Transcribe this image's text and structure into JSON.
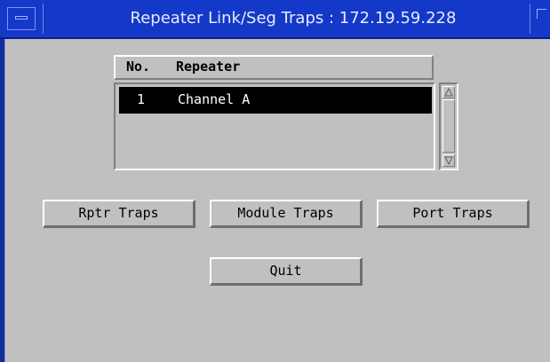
{
  "window": {
    "title": "Repeater Link/Seg Traps : 172.19.59.228"
  },
  "list": {
    "columns": [
      "No.",
      "Repeater"
    ],
    "rows": [
      {
        "no": "1",
        "repeater": "Channel A"
      }
    ]
  },
  "buttons": {
    "rptr_traps": "Rptr Traps",
    "module_traps": "Module Traps",
    "port_traps": "Port Traps",
    "quit": "Quit"
  },
  "colors": {
    "titlebar": "#1438c8",
    "background": "#c0c0c0",
    "selection": "#000000"
  },
  "icons": {
    "window_menu": "window-menu-icon",
    "scroll_up": "arrow-up-icon",
    "scroll_down": "arrow-down-icon"
  }
}
